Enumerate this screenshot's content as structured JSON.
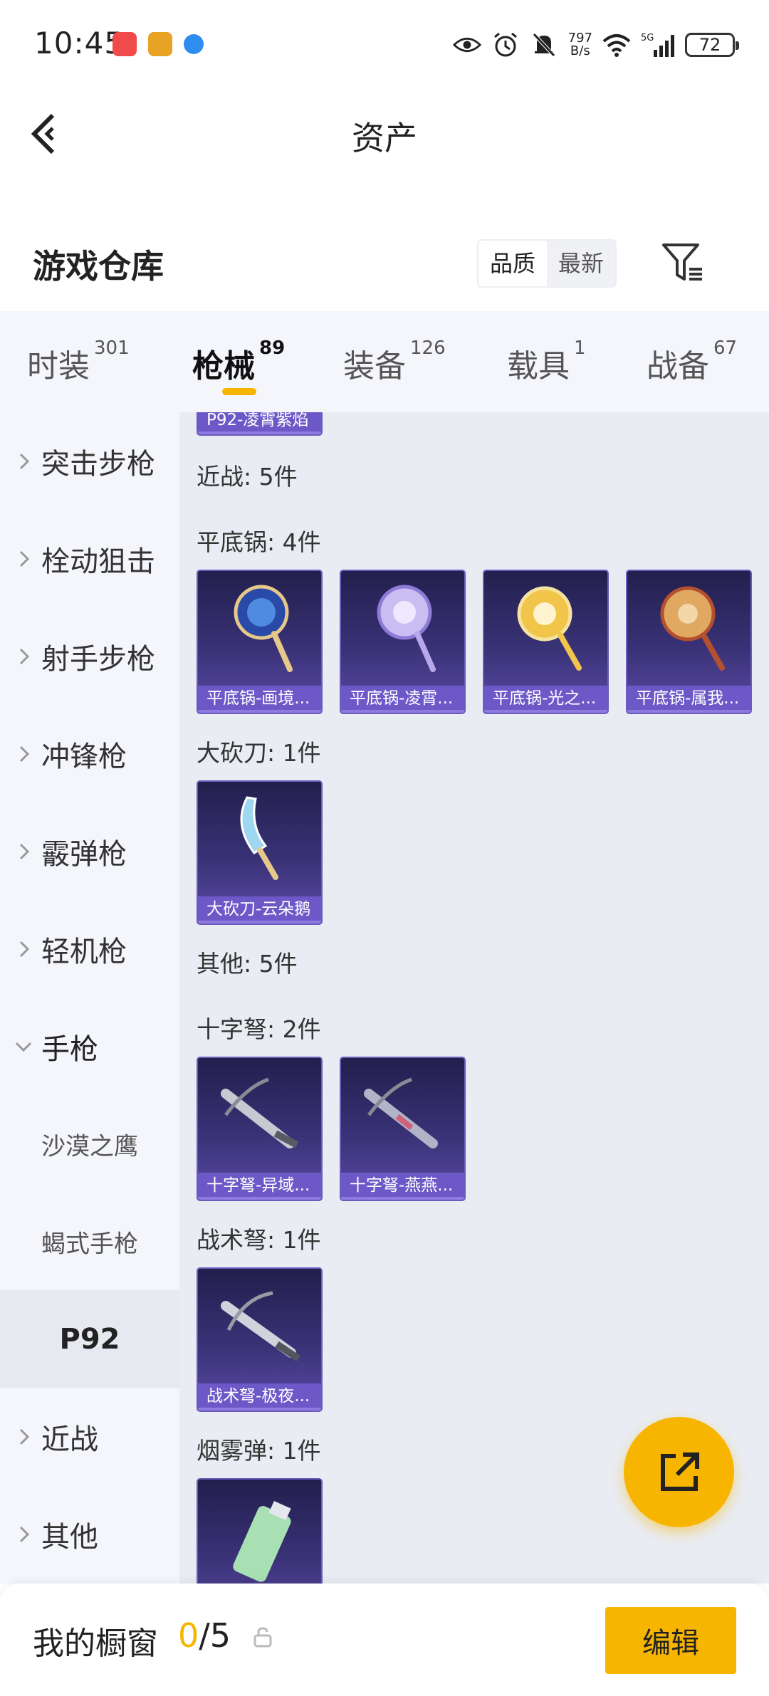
{
  "status_bar": {
    "time": "10:45",
    "net_speed_value": "797",
    "net_speed_unit": "B/s",
    "network": "5G",
    "battery": "72"
  },
  "nav": {
    "title": "资产"
  },
  "warehouse": {
    "title": "游戏仓库",
    "sort_quality": "品质",
    "sort_latest": "最新"
  },
  "categories": [
    {
      "label": "时装",
      "count": "301"
    },
    {
      "label": "枪械",
      "count": "89"
    },
    {
      "label": "装备",
      "count": "126"
    },
    {
      "label": "载具",
      "count": "1"
    },
    {
      "label": "战备",
      "count": "67"
    }
  ],
  "sidebar": {
    "items": [
      {
        "label": "突击步枪"
      },
      {
        "label": "栓动狙击"
      },
      {
        "label": "射手步枪"
      },
      {
        "label": "冲锋枪"
      },
      {
        "label": "霰弹枪"
      },
      {
        "label": "轻机枪"
      },
      {
        "label": "手枪"
      },
      {
        "label": "沙漠之鹰"
      },
      {
        "label": "蝎式手枪"
      },
      {
        "label": "P92"
      },
      {
        "label": "近战"
      },
      {
        "label": "其他"
      }
    ]
  },
  "content": {
    "top_partial_item": "P92-凌霄紫焰",
    "melee_header": "近战: 5件",
    "pan_header": "平底锅: 4件",
    "pans": [
      "平底锅-画境...",
      "平底锅-凌霄...",
      "平底锅-光之...",
      "平底锅-属我..."
    ],
    "machete_header": "大砍刀: 1件",
    "machetes": [
      "大砍刀-云朵鹅"
    ],
    "other_header": "其他: 5件",
    "crossbow_header": "十字弩: 2件",
    "crossbows": [
      "十字弩-异域...",
      "十字弩-燕燕..."
    ],
    "tactical_header": "战术弩: 1件",
    "tactical": [
      "战术弩-极夜..."
    ],
    "smoke_header": "烟雾弹: 1件"
  },
  "bottom": {
    "title": "我的橱窗",
    "count_current": "0",
    "count_total": "/5",
    "edit_label": "编辑"
  },
  "colors": {
    "accent": "#f7b500",
    "tile_bg": "#3a3277",
    "tile_label": "#6d58c7",
    "panel_bg": "#e9ecf2",
    "sidebar_bg": "#f4f6fb"
  }
}
